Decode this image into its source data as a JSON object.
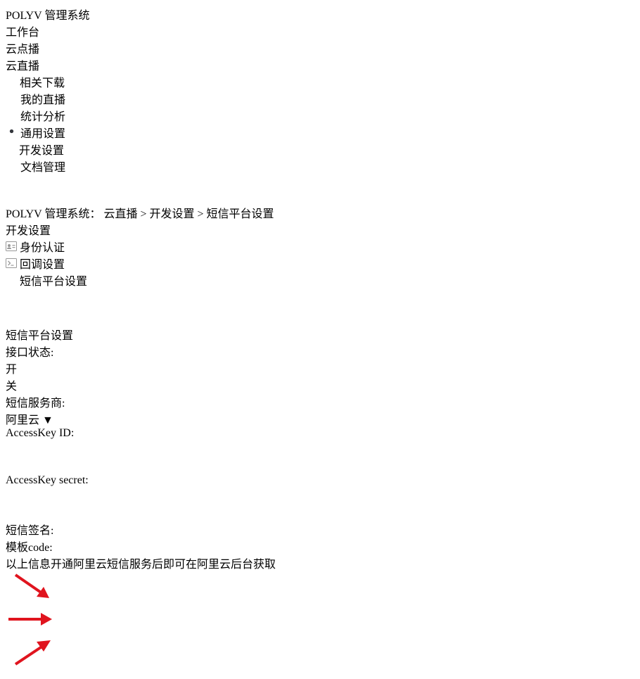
{
  "header": {
    "logo": "POLYV",
    "system_name": "管理系统",
    "tabs": [
      {
        "label": "工作台"
      },
      {
        "label": "云点播"
      },
      {
        "label": "云直播"
      }
    ],
    "download_label": "相关下载"
  },
  "subnav": {
    "items": [
      {
        "label": "我的直播",
        "icon": "home-icon"
      },
      {
        "label": "统计分析",
        "icon": "bar-chart-icon"
      },
      {
        "label": "通用设置",
        "icon": "gear-icon"
      },
      {
        "label": "开发设置",
        "icon": "grid-icon"
      },
      {
        "label": "文档管理",
        "icon": "folder-icon"
      }
    ]
  },
  "breadcrumb": {
    "prefix": "POLYV 管理系统：",
    "links": [
      "云直播",
      "开发设置"
    ],
    "sep": ">",
    "current": "短信平台设置"
  },
  "sidebar": {
    "header": "开发设置",
    "items": [
      {
        "label": "身份认证"
      },
      {
        "label": "回调设置"
      },
      {
        "label": "短信平台设置"
      }
    ]
  },
  "panel": {
    "title": "短信平台设置",
    "interface_status_label": "接口状态:",
    "on_label": "开",
    "off_label": "关",
    "provider_label": "短信服务商:",
    "provider_value": "阿里云",
    "accesskey_id_label": "AccessKey ID:",
    "accesskey_secret_label": "AccessKey secret:",
    "sign_label": "短信签名:",
    "template_label": "模板code:",
    "note_pre": "以上信息开通",
    "note_link": "阿里云短信服务",
    "note_post": "后即可在阿里云后台获取"
  },
  "colors": {
    "accent": "#2a9be5",
    "topbar": "#25272b",
    "subbar": "#34373d",
    "highlight": "#e0141e"
  }
}
